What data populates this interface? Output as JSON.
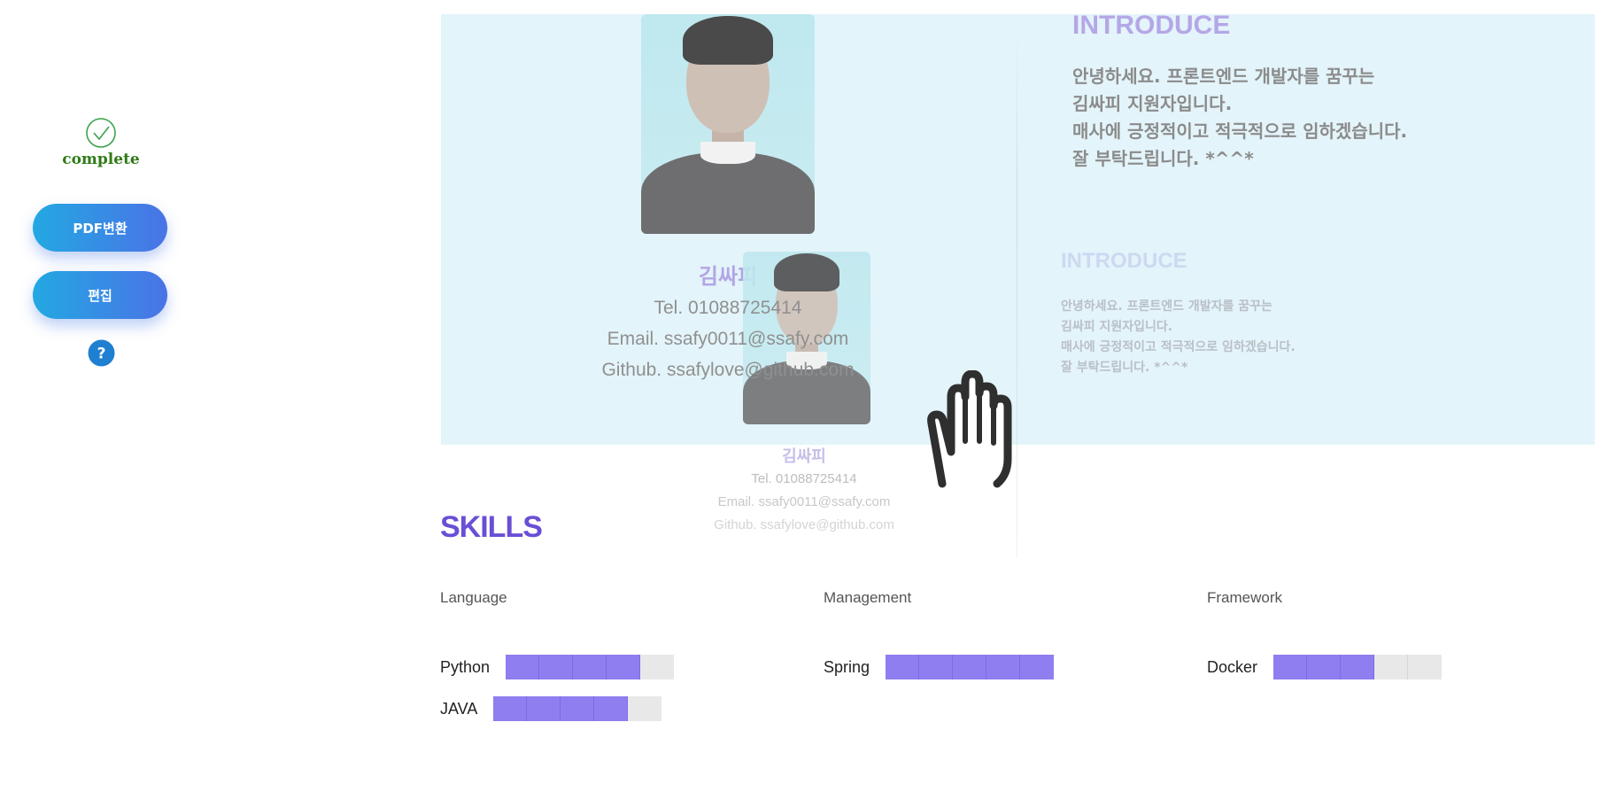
{
  "sidebar": {
    "status_text": "complete",
    "pdf_button": "PDF변환",
    "edit_button": "편집",
    "help_icon": "?"
  },
  "profile": {
    "name": "김싸피",
    "tel": "Tel. 01088725414",
    "email": "Email. ssafy0011@ssafy.com",
    "github": "Github. ssafylove@github.com"
  },
  "introduce": {
    "title": "INTRODUCE",
    "lines": [
      "안녕하세요. 프론트엔드 개발자를 꿈꾸는",
      "김싸피 지원자입니다.",
      "매사에 긍정적이고 적극적으로 임하겠습니다.",
      "잘 부탁드립니다. *^^*"
    ]
  },
  "skills": {
    "title": "SKILLS",
    "categories": [
      {
        "label": "Language",
        "items": [
          {
            "name": "Python",
            "level": 4,
            "max": 5
          },
          {
            "name": "JAVA",
            "level": 4,
            "max": 5
          }
        ]
      },
      {
        "label": "Management",
        "items": [
          {
            "name": "Spring",
            "level": 5,
            "max": 5
          }
        ]
      },
      {
        "label": "Framework",
        "items": [
          {
            "name": "Docker",
            "level": 3,
            "max": 5
          }
        ]
      }
    ]
  },
  "colors": {
    "accent": "#6a4fd6",
    "bar_filled": "#8f7ef0",
    "bar_empty": "#e8e8e8",
    "panel_bg": "#e3f4fa",
    "complete": "#2f7a17"
  },
  "icons": {
    "status": "check-circle-icon",
    "help": "question-circle-icon",
    "cursor": "grab-hand-cursor-icon"
  }
}
